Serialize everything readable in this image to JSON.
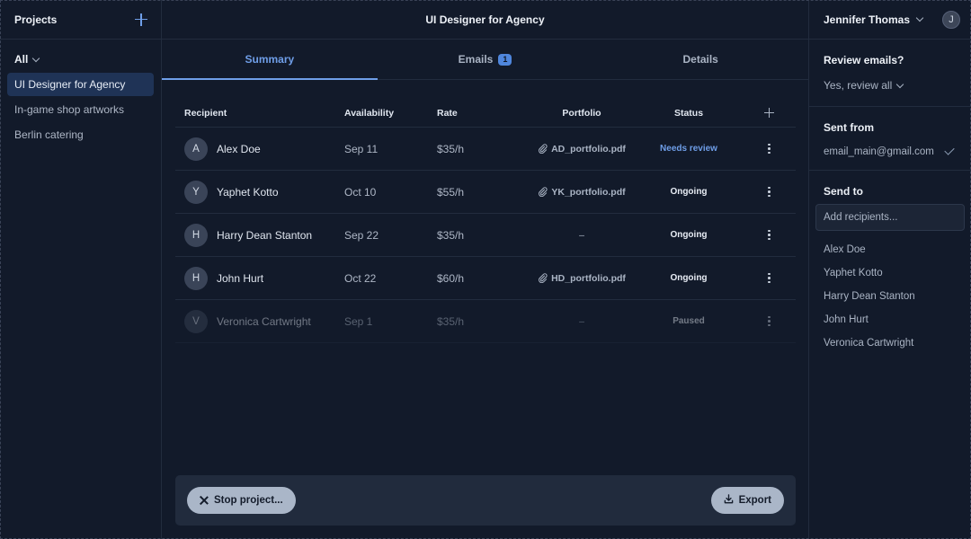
{
  "left": {
    "title": "Projects",
    "filter_label": "All",
    "projects": [
      {
        "label": "UI Designer for Agency",
        "active": true
      },
      {
        "label": "In-game shop artworks",
        "active": false
      },
      {
        "label": "Berlin catering",
        "active": false
      }
    ]
  },
  "center": {
    "title": "UI Designer for Agency",
    "tabs": [
      {
        "label": "Summary",
        "active": true
      },
      {
        "label": "Emails",
        "badge": "1"
      },
      {
        "label": "Details"
      }
    ],
    "columns": {
      "recipient": "Recipient",
      "availability": "Availability",
      "rate": "Rate",
      "portfolio": "Portfolio",
      "status": "Status"
    },
    "rows": [
      {
        "initial": "A",
        "name": "Alex Doe",
        "availability": "Sep 11",
        "rate": "$35/h",
        "portfolio": "AD_portfolio.pdf",
        "status": "Needs review"
      },
      {
        "initial": "Y",
        "name": "Yaphet Kotto",
        "availability": "Oct 10",
        "rate": "$55/h",
        "portfolio": "YK_portfolio.pdf",
        "status": "Ongoing"
      },
      {
        "initial": "H",
        "name": "Harry Dean Stanton",
        "availability": "Sep 22",
        "rate": "$35/h",
        "portfolio": "–",
        "status": "Ongoing"
      },
      {
        "initial": "H",
        "name": "John Hurt",
        "availability": "Oct 22",
        "rate": "$60/h",
        "portfolio": "HD_portfolio.pdf",
        "status": "Ongoing"
      },
      {
        "initial": "V",
        "name": "Veronica Cartwright",
        "availability": "Sep 1",
        "rate": "$35/h",
        "portfolio": "–",
        "status": "Paused"
      }
    ],
    "stop_label": "Stop project...",
    "export_label": "Export"
  },
  "right": {
    "user_name": "Jennifer Thomas",
    "user_initial": "J",
    "review_title": "Review emails?",
    "review_value": "Yes, review all",
    "sent_from_title": "Sent from",
    "sent_from_value": "email_main@gmail.com",
    "send_to_title": "Send to",
    "recipients_placeholder": "Add recipients...",
    "recipients": [
      "Alex Doe",
      "Yaphet Kotto",
      "Harry Dean Stanton",
      "John Hurt",
      "Veronica Cartwright"
    ]
  },
  "colors": {
    "background": "#121a2a",
    "accent": "#6f9ee8",
    "active_item": "#1f3356",
    "footer_bar": "#212b3d",
    "button": "#aab6c8"
  },
  "icons": [
    "plus-icon",
    "chevron-down-icon",
    "paperclip-icon",
    "more-vertical-icon",
    "close-icon",
    "download-icon",
    "check-icon"
  ]
}
